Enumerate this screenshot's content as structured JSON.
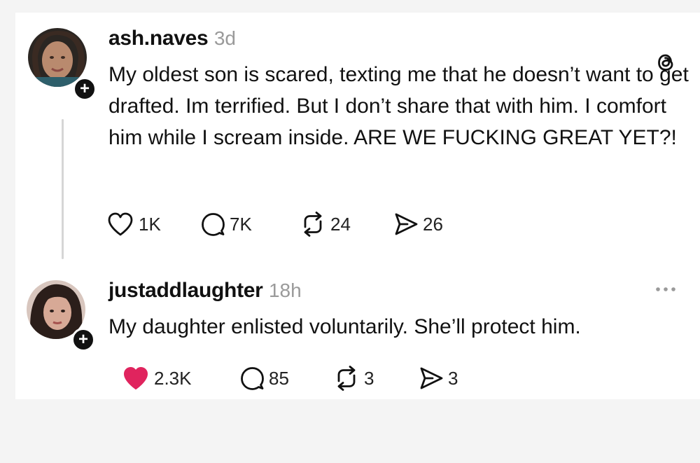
{
  "posts": [
    {
      "username": "ash.naves",
      "time": "3d",
      "text": "My oldest son is scared, texting me that he doesn’t want to get drafted. Im terrified. But I don’t share that with him. I comfort him while I scream inside. ARE WE FUCKING GREAT YET?!",
      "actions": {
        "likes": "1K",
        "replies": "7K",
        "reposts": "24",
        "shares": "26"
      },
      "liked": false,
      "corner_icon": "threads-logo-icon"
    },
    {
      "username": "justaddlaughter",
      "time": "18h",
      "text": "My daughter enlisted voluntarily. She’ll protect him.",
      "actions": {
        "likes": "2.3K",
        "replies": "85",
        "reposts": "3",
        "shares": "3"
      },
      "liked": true,
      "corner_icon": "more-options-icon"
    }
  ],
  "follow_badge": "+",
  "colors": {
    "background": "#f4f4f4",
    "card": "#ffffff",
    "text": "#111111",
    "muted": "#9a9a9a",
    "like_active": "#e0245e",
    "thread_line": "#d6d6d6"
  }
}
